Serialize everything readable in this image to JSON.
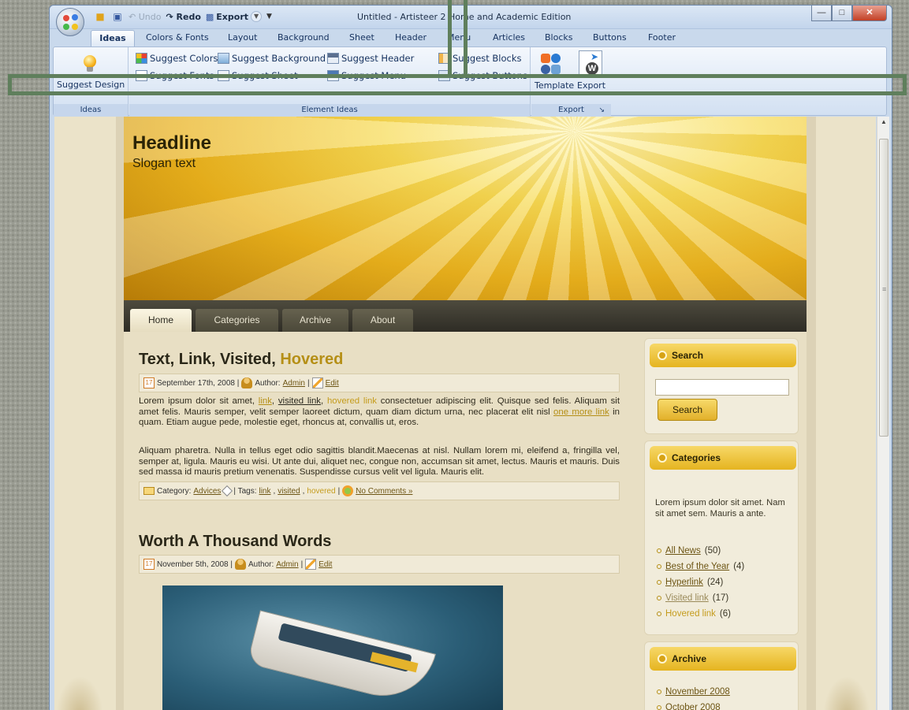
{
  "window": {
    "title": "Untitled - Artisteer 2 Home and Academic Edition",
    "quick_access": {
      "undo": "Undo",
      "redo": "Redo",
      "export": "Export"
    }
  },
  "ribbon": {
    "tabs": [
      "Ideas",
      "Colors & Fonts",
      "Layout",
      "Background",
      "Sheet",
      "Header",
      "Menu",
      "Articles",
      "Blocks",
      "Buttons",
      "Footer"
    ],
    "ideas_group": {
      "button": "Suggest Design",
      "label": "Ideas"
    },
    "element_ideas": {
      "label": "Element Ideas",
      "row1": [
        "Suggest Colors",
        "Suggest Background",
        "Suggest Header",
        "Suggest Blocks"
      ],
      "row2": [
        "Suggest Fonts",
        "Suggest Sheet",
        "Suggest Menu",
        "Suggest Buttons"
      ]
    },
    "export_group": {
      "template": "Template",
      "export": "Export",
      "label": "Export"
    }
  },
  "site": {
    "headline": "Headline",
    "slogan": "Slogan text",
    "menu": [
      "Home",
      "Categories",
      "Archive",
      "About"
    ],
    "post1": {
      "title_plain": "Text, Link, Visited, ",
      "title_hover": "Hovered",
      "date": "September 17th, 2008 |",
      "author_label": "Author:",
      "author": "Admin",
      "sep": "|",
      "edit": "Edit",
      "p1_a": "Lorem ipsum dolor sit amet, ",
      "p1_link": "link",
      "p1_b": ", ",
      "p1_visited": "visited link",
      "p1_c": ", ",
      "p1_hovered": "hovered link",
      "p1_d": " consectetuer adipiscing elit. Quisque sed felis. Aliquam sit amet felis. Mauris semper, velit semper laoreet dictum, quam diam dictum urna, nec placerat elit nisl ",
      "p1_more": "one more link",
      "p1_e": " in quam. Etiam augue pede, molestie eget, rhoncus at, convallis ut, eros.",
      "p2": "Aliquam pharetra. Nulla in tellus eget odio sagittis blandit.Maecenas at nisl. Nullam lorem mi, eleifend a, fringilla vel, semper at, ligula. Mauris eu wisi. Ut ante dui, aliquet nec, congue non, accumsan sit amet, lectus. Mauris et mauris. Duis sed massa id mauris pretium venenatis. Suspendisse cursus velit vel ligula. Mauris elit.",
      "category_label": "Category:",
      "category": "Advices",
      "tags_label": "| Tags:",
      "tag1": "link",
      "tag2": "visited",
      "tag3": "hovered",
      "comments": "No Comments »"
    },
    "post2": {
      "title": "Worth A Thousand Words",
      "date": "November 5th, 2008 |",
      "author_label": "Author:",
      "author": "Admin",
      "sep": "|",
      "edit": "Edit"
    },
    "sidebar": {
      "search": {
        "title": "Search",
        "button": "Search"
      },
      "categories": {
        "title": "Categories",
        "text": "Lorem ipsum dolor sit amet. Nam sit amet sem. Mauris a ante.",
        "items": [
          {
            "label": "All News",
            "count": "(50)"
          },
          {
            "label": "Best of the Year",
            "count": "(4)"
          },
          {
            "label": "Hyperlink",
            "count": "(24)"
          },
          {
            "label": "Visited link",
            "count": "(17)"
          },
          {
            "label": "Hovered link",
            "count": "(6)"
          }
        ]
      },
      "archive": {
        "title": "Archive",
        "items": [
          "November 2008",
          "October 2008"
        ]
      }
    }
  }
}
